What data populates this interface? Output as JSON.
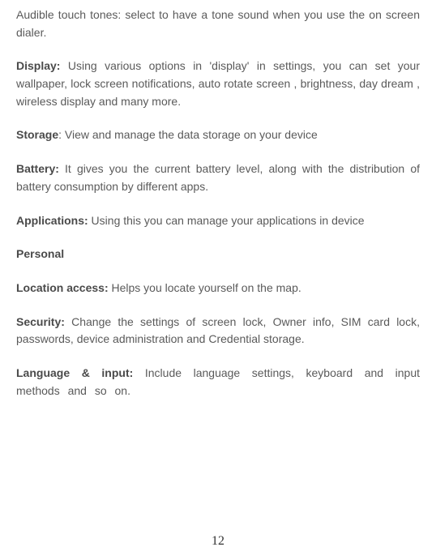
{
  "paragraphs": {
    "audible": "Audible touch tones: select to have a tone sound when you use the on screen dialer.",
    "display": {
      "lead": "Display:",
      "text": " Using various options in 'display' in settings, you can set your wallpaper, lock screen notifications, auto rotate screen , brightness, day dream , wireless display and many more."
    },
    "storage": {
      "lead": "Storage",
      "text": ": View and manage the data storage on your device"
    },
    "battery": {
      "lead": "Battery:",
      "text": " It gives you the current battery level, along with the distribution of battery consumption by different apps."
    },
    "applications": {
      "lead": "Applications:",
      "text": " Using this you can manage your applications in device"
    },
    "personal_heading": "Personal",
    "location": {
      "lead": "Location access:",
      "text": " Helps you locate yourself on the map."
    },
    "security": {
      "lead": "Security:",
      "text": " Change the settings of screen lock, Owner info, SIM card lock, passwords, device administration and Credential storage."
    },
    "language": {
      "lead": "Language & input:",
      "text": " Include language settings, keyboard and input methods and so on."
    }
  },
  "page_number": "12"
}
